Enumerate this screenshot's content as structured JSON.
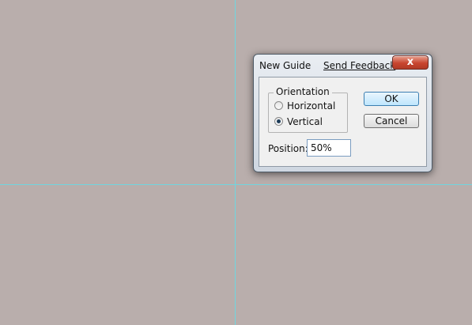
{
  "dialog": {
    "title": "New Guide",
    "feedback_link": "Send Feedback",
    "close_glyph": "x"
  },
  "orientation": {
    "label": "Orientation",
    "options": [
      {
        "label": "Horizontal",
        "selected": false
      },
      {
        "label": "Vertical",
        "selected": true
      }
    ]
  },
  "buttons": {
    "ok": "OK",
    "cancel": "Cancel"
  },
  "position": {
    "label": "Position:",
    "value": "50%"
  },
  "colors": {
    "canvas": "#b9aeac",
    "guide": "#6fd6e0",
    "close_button": "#c8452f"
  }
}
